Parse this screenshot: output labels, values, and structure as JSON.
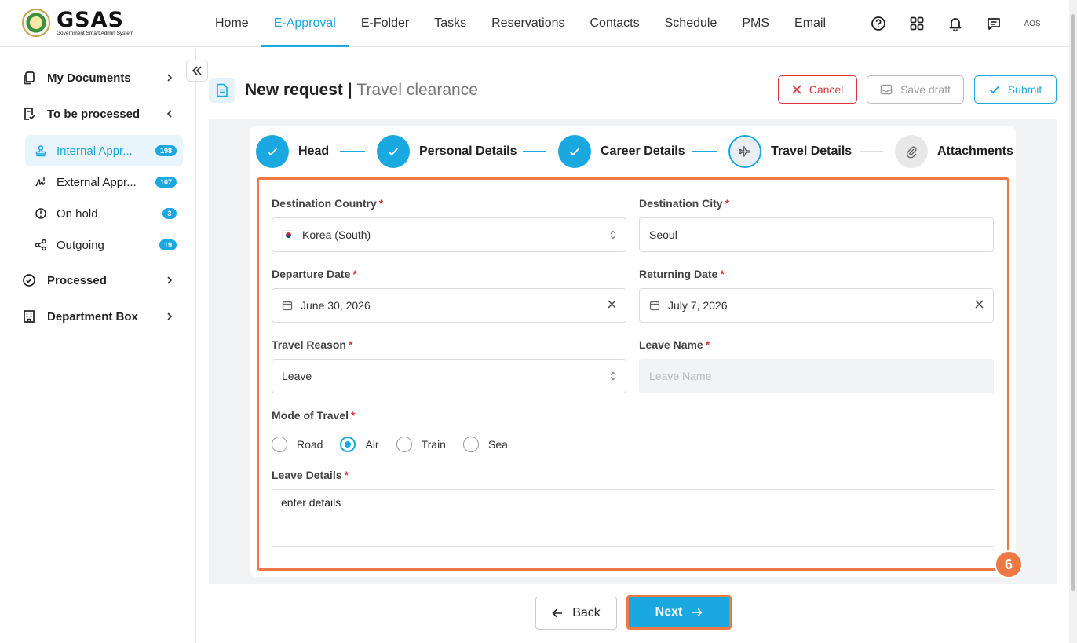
{
  "app": {
    "logo_title": "GSAS",
    "logo_subtitle": "Government Smart Admin System",
    "avatar_text": "AOS"
  },
  "nav": {
    "items": [
      "Home",
      "E-Approval",
      "E-Folder",
      "Tasks",
      "Reservations",
      "Contacts",
      "Schedule",
      "PMS",
      "Email"
    ],
    "active": "E-Approval"
  },
  "sidebar": {
    "my_documents": "My Documents",
    "to_be_processed": "To be processed",
    "internal": {
      "label": "Internal Appr...",
      "count": "198"
    },
    "external": {
      "label": "External Appr...",
      "count": "107"
    },
    "on_hold": {
      "label": "On hold",
      "count": "3"
    },
    "outgoing": {
      "label": "Outgoing",
      "count": "19"
    },
    "processed": "Processed",
    "department_box": "Department Box"
  },
  "header": {
    "title": "New request",
    "separator": " | ",
    "subtitle": "Travel clearance",
    "cancel": "Cancel",
    "save_draft": "Save draft",
    "submit": "Submit"
  },
  "stepper": {
    "steps": [
      "Head",
      "Personal Details",
      "Career Details",
      "Travel Details",
      "Attachments"
    ],
    "current": "Travel Details"
  },
  "form": {
    "destination_country": {
      "label": "Destination Country",
      "value": "Korea (South)"
    },
    "destination_city": {
      "label": "Destination City",
      "value": "Seoul"
    },
    "departure_date": {
      "label": "Departure Date",
      "value": "June 30, 2026"
    },
    "returning_date": {
      "label": "Returning Date",
      "value": "July 7, 2026"
    },
    "travel_reason": {
      "label": "Travel Reason",
      "value": "Leave"
    },
    "leave_name": {
      "label": "Leave Name",
      "placeholder": "Leave Name"
    },
    "mode_of_travel": {
      "label": "Mode of Travel",
      "options": [
        "Road",
        "Air",
        "Train",
        "Sea"
      ],
      "selected": "Air"
    },
    "leave_details": {
      "label": "Leave Details",
      "value": "enter details"
    },
    "required_mark": "*"
  },
  "step_marker": "6",
  "footer": {
    "back": "Back",
    "next": "Next"
  },
  "colors": {
    "accent": "#1aa8e0",
    "danger": "#d9363e",
    "highlight": "#f07845"
  }
}
